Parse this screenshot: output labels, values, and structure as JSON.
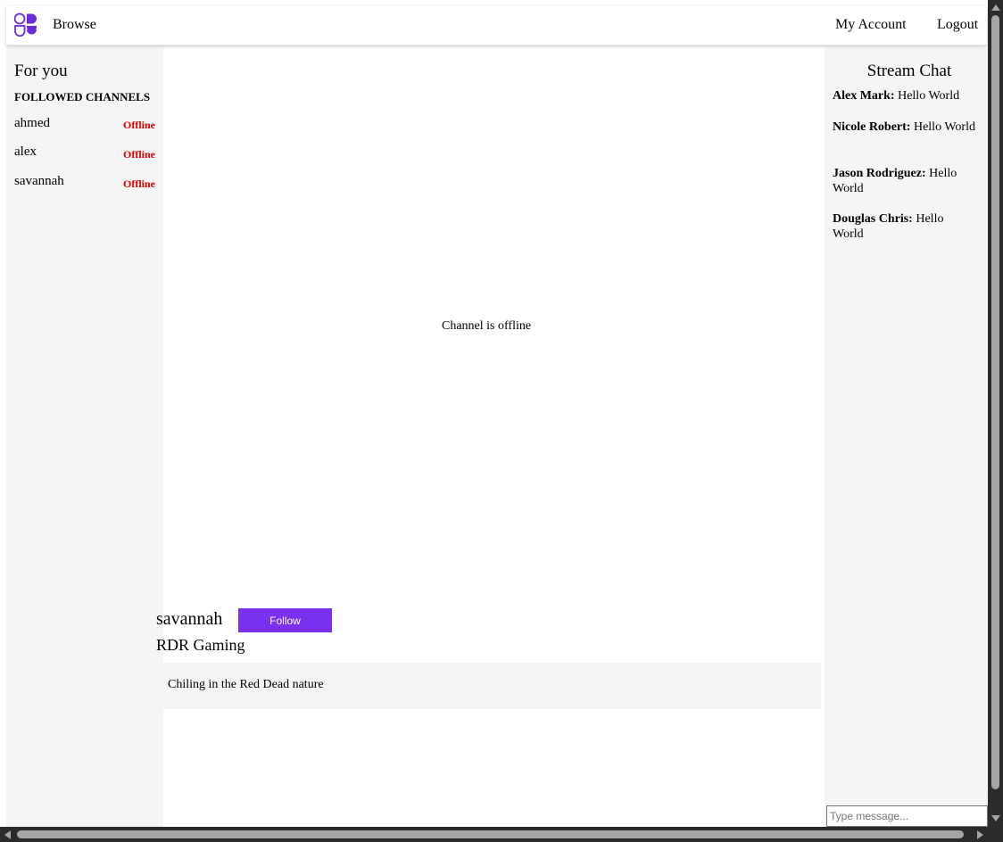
{
  "nav": {
    "browse_label": "Browse",
    "account_label": "My Account",
    "logout_label": "Logout",
    "logo_icon": "app-logo-icon",
    "logo_color": "#6b2bd9"
  },
  "sidebar": {
    "title": "For you",
    "subtitle": "FOLLOWED CHANNELS",
    "channels": [
      {
        "name": "ahmed",
        "status": "Offline"
      },
      {
        "name": "alex",
        "status": "Offline"
      },
      {
        "name": "savannah",
        "status": "Offline"
      }
    ],
    "status_color": "#e00000"
  },
  "player": {
    "offline_message": "Channel is offline"
  },
  "channel": {
    "streamer": "savannah",
    "follow_label": "Follow",
    "stream_title": "RDR Gaming",
    "description": "Chiling in the Red Dead nature",
    "accent_color": "#7b2ff0"
  },
  "chat": {
    "title": "Stream Chat",
    "messages": [
      {
        "author": "Alex Mark:",
        "text": "Hello World"
      },
      {
        "author": "Nicole Robert:",
        "text": "Hello World"
      },
      {
        "author": "Jason Rodriguez:",
        "text": "Hello World"
      },
      {
        "author": "Douglas Chris:",
        "text": "Hello World"
      }
    ],
    "input_placeholder": "Type message..."
  }
}
